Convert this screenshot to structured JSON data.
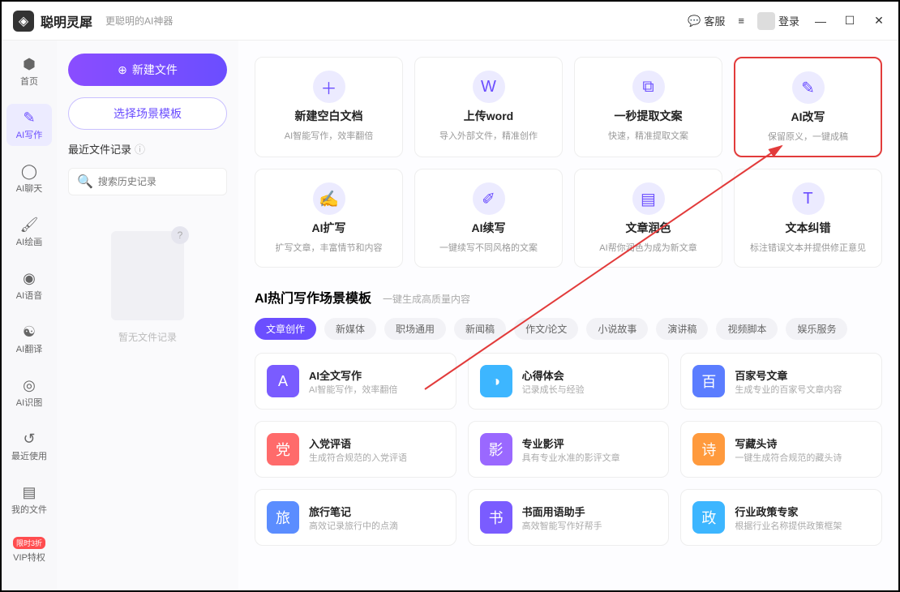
{
  "app": {
    "title": "聪明灵犀",
    "subtitle": "更聪明的AI神器"
  },
  "titlebar": {
    "support": "客服",
    "login": "登录"
  },
  "nav": [
    {
      "icon": "⬢",
      "label": "首页"
    },
    {
      "icon": "✎",
      "label": "AI写作",
      "active": true
    },
    {
      "icon": "◯",
      "label": "AI聊天"
    },
    {
      "icon": "🖌",
      "label": "AI绘画"
    },
    {
      "icon": "◉",
      "label": "AI语音"
    },
    {
      "icon": "☯",
      "label": "AI翻译"
    },
    {
      "icon": "◎",
      "label": "AI识图"
    },
    {
      "icon": "↺",
      "label": "最近使用"
    },
    {
      "icon": "▤",
      "label": "我的文件"
    },
    {
      "icon": "",
      "label": "VIP特权",
      "badge": "限时3折"
    }
  ],
  "side": {
    "new_file": "新建文件",
    "choose_template": "选择场景模板",
    "recent_label": "最近文件记录",
    "search_placeholder": "搜索历史记录",
    "empty_text": "暂无文件记录"
  },
  "actions": [
    {
      "icon": "＋",
      "title": "新建空白文档",
      "desc": "AI智能写作，效率翻倍"
    },
    {
      "icon": "W",
      "title": "上传word",
      "desc": "导入外部文件，精准创作"
    },
    {
      "icon": "⧉",
      "title": "一秒提取文案",
      "desc": "快速，精准提取文案"
    },
    {
      "icon": "✎",
      "title": "AI改写",
      "desc": "保留原义，一键成稿",
      "highlight": true
    },
    {
      "icon": "✍",
      "title": "AI扩写",
      "desc": "扩写文章，丰富情节和内容"
    },
    {
      "icon": "✐",
      "title": "AI续写",
      "desc": "一键续写不同风格的文案"
    },
    {
      "icon": "▤",
      "title": "文章润色",
      "desc": "AI帮你润色为成为新文章"
    },
    {
      "icon": "T",
      "title": "文本纠错",
      "desc": "标注错误文本并提供修正意见"
    }
  ],
  "sec2": {
    "title": "AI热门写作场景模板",
    "subtitle": "一键生成高质量内容"
  },
  "tabs": [
    {
      "label": "文章创作",
      "active": true
    },
    {
      "label": "新媒体"
    },
    {
      "label": "职场通用"
    },
    {
      "label": "新闻稿"
    },
    {
      "label": "作文/论文"
    },
    {
      "label": "小说故事"
    },
    {
      "label": "演讲稿"
    },
    {
      "label": "视频脚本"
    },
    {
      "label": "娱乐服务"
    }
  ],
  "templates": [
    {
      "color": "#7a5cff",
      "icon": "A",
      "title": "AI全文写作",
      "desc": "AI智能写作，效率翻倍"
    },
    {
      "color": "#3db6ff",
      "icon": "◑",
      "title": "心得体会",
      "desc": "记录成长与经验"
    },
    {
      "color": "#5b7dff",
      "icon": "百",
      "title": "百家号文章",
      "desc": "生成专业的百家号文章内容"
    },
    {
      "color": "#ff6b6b",
      "icon": "党",
      "title": "入党评语",
      "desc": "生成符合规范的入党评语"
    },
    {
      "color": "#9a68ff",
      "icon": "影",
      "title": "专业影评",
      "desc": "具有专业水准的影评文章"
    },
    {
      "color": "#ff9a3d",
      "icon": "诗",
      "title": "写藏头诗",
      "desc": "一键生成符合规范的藏头诗"
    },
    {
      "color": "#5b8dff",
      "icon": "旅",
      "title": "旅行笔记",
      "desc": "高效记录旅行中的点滴"
    },
    {
      "color": "#7a5cff",
      "icon": "书",
      "title": "书面用语助手",
      "desc": "高效智能写作好帮手"
    },
    {
      "color": "#3db6ff",
      "icon": "政",
      "title": "行业政策专家",
      "desc": "根据行业名称提供政策框架"
    }
  ]
}
